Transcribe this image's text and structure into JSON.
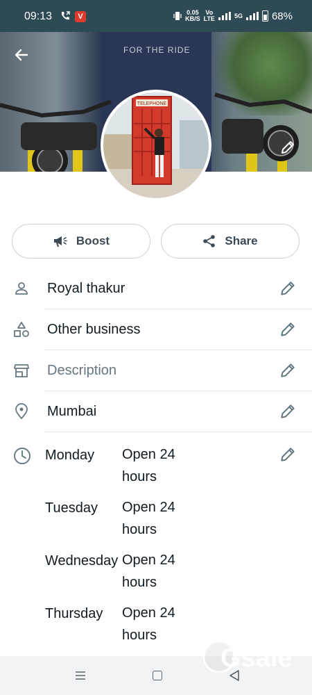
{
  "status_bar": {
    "time": "09:13",
    "speed_value": "0.05",
    "speed_unit": "KB/S",
    "network_label": "5G",
    "battery": "68%"
  },
  "cover": {
    "wall_text": "FOR THE RIDE"
  },
  "actions": {
    "boost_label": "Boost",
    "share_label": "Share"
  },
  "profile": {
    "name": "Royal thakur",
    "category": "Other business",
    "description_placeholder": "Description",
    "location": "Mumbai"
  },
  "hours": [
    {
      "day": "Monday",
      "value": "Open 24 hours"
    },
    {
      "day": "Tuesday",
      "value": "Open 24 hours"
    },
    {
      "day": "Wednesday",
      "value": "Open 24 hours"
    },
    {
      "day": "Thursday",
      "value": "Open 24 hours"
    }
  ],
  "watermark": "Gsale",
  "colors": {
    "status_bar": "#2e4a54",
    "icon_grey": "#667781",
    "edit_icon": "#5f7580",
    "button_border": "#c9d1d6"
  }
}
